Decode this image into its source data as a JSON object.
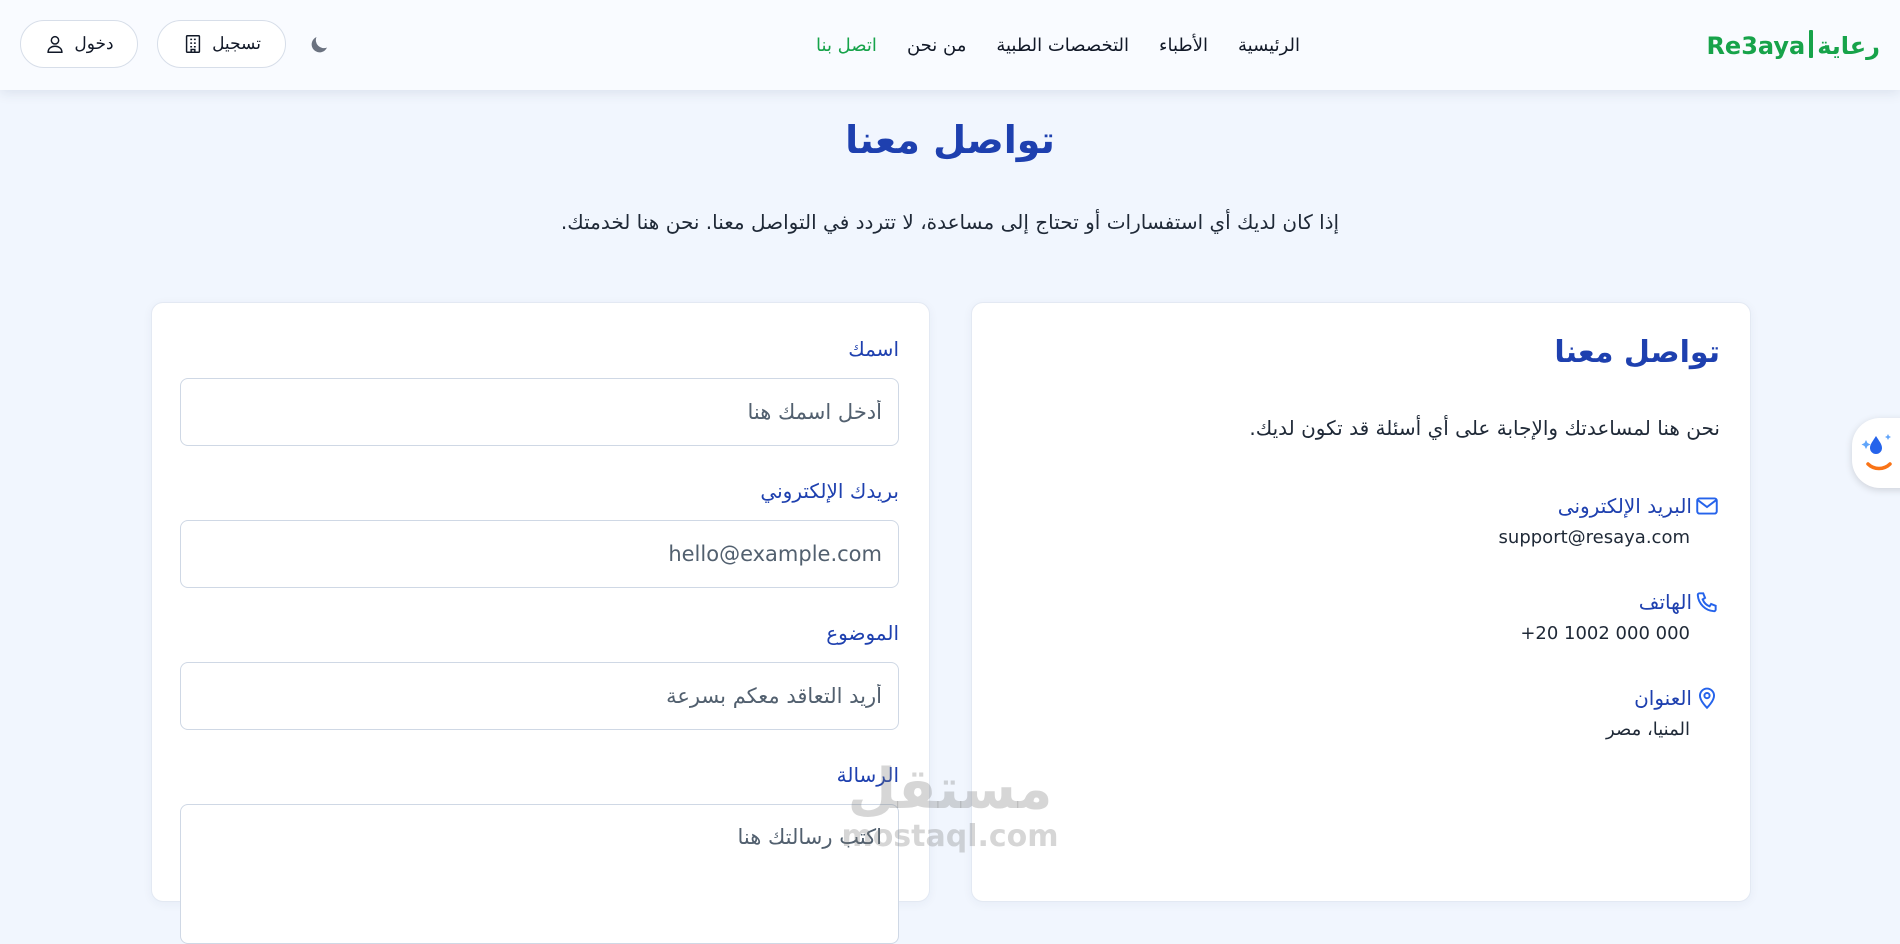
{
  "brand": {
    "logo_arabic": "رعاية",
    "logo_latin": "Re3aya"
  },
  "nav": {
    "links": [
      {
        "label": "الرئيسية"
      },
      {
        "label": "الأطباء"
      },
      {
        "label": "التخصصات الطبية"
      },
      {
        "label": "من نحن"
      },
      {
        "label": "اتصل بنا"
      }
    ],
    "active_index": 4,
    "register_label": "تسجيل",
    "login_label": "دخول"
  },
  "page": {
    "title": "تواصل معنا",
    "subtitle": "إذا كان لديك أي استفسارات أو تحتاج إلى مساعدة، لا تتردد في التواصل معنا. نحن هنا لخدمتك."
  },
  "info": {
    "title": "تواصل معنا",
    "description": "نحن هنا لمساعدتك والإجابة على أي أسئلة قد تكون لديك.",
    "email_label": "البريد الإلكترونى",
    "email_value": "support@resaya.com",
    "phone_label": "الهاتف",
    "phone_value": "+20 1002 000 000",
    "address_label": "العنوان",
    "address_value": "المنيا، مصر"
  },
  "form": {
    "name_label": "اسمك",
    "name_placeholder": "أدخل اسمك هنا",
    "email_label": "بريدك الإلكتروني",
    "email_placeholder": "hello@example.com",
    "subject_label": "الموضوع",
    "subject_placeholder": "أريد التعاقد معكم بسرعة",
    "message_label": "الرسالة",
    "message_placeholder": "اكتب رسالتك هنا"
  },
  "watermark": {
    "arabic": "مستقل",
    "latin": "mostaql.com"
  },
  "colors": {
    "brand_green": "#16a34a",
    "primary_blue": "#1e40af",
    "page_bg": "#f1f6fe"
  }
}
